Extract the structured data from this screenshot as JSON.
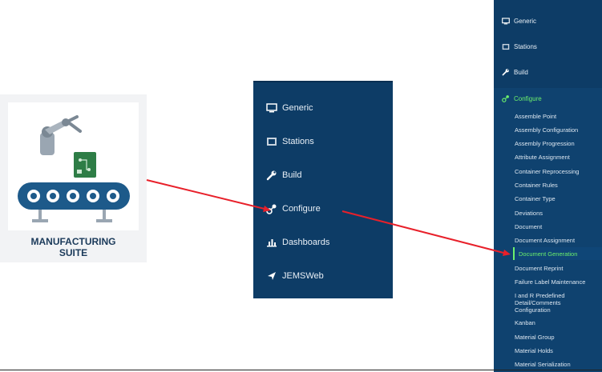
{
  "logo": {
    "line1": "MANUFACTURING",
    "line2": "SUITE",
    "colors": {
      "text": "#1b3a5a",
      "belt": "#1d5a8a",
      "board": "#2e7d46",
      "arm": "#9aa6b2"
    }
  },
  "menu2": {
    "items": [
      {
        "label": "Generic",
        "icon": "monitor-icon"
      },
      {
        "label": "Stations",
        "icon": "station-icon"
      },
      {
        "label": "Build",
        "icon": "wrench-icon"
      },
      {
        "label": "Configure",
        "icon": "gear-key-icon"
      },
      {
        "label": "Dashboards",
        "icon": "bar-chart-icon"
      },
      {
        "label": "JEMSWeb",
        "icon": "send-arrow-icon"
      }
    ]
  },
  "menu3": {
    "items": [
      {
        "label": "Generic",
        "icon": "monitor-icon"
      },
      {
        "label": "Stations",
        "icon": "station-icon"
      },
      {
        "label": "Build",
        "icon": "wrench-icon"
      },
      {
        "label": "Configure",
        "icon": "gear-key-icon"
      }
    ],
    "submenu": [
      "Assemble Point",
      "Assembly Configuration",
      "Assembly Progression",
      "Attribute Assignment",
      "Container Reprocessing",
      "Container Rules",
      "Container Type",
      "Deviations",
      "Document",
      "Document Assignment",
      "Document Generation",
      "Document Reprint",
      "Failure Label Maintenance",
      "I and R Predefined Detail/Comments Configuration",
      "Kanban",
      "Material Group",
      "Material Holds",
      "Material Serialization"
    ],
    "selected": "Document Generation"
  },
  "theme": {
    "menu_bg": "#0d3c66",
    "highlight": "#6cf06c",
    "arrow": "#e8202a"
  }
}
